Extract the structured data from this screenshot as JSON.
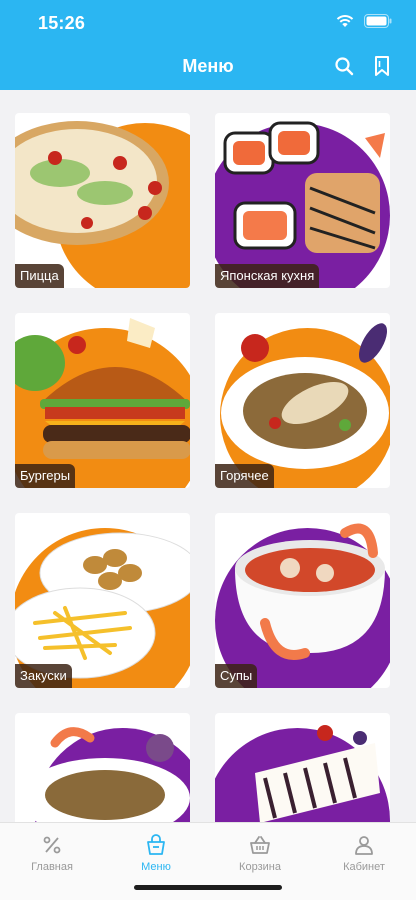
{
  "status": {
    "time": "15:26"
  },
  "header": {
    "title": "Меню"
  },
  "categories": [
    {
      "label": "Пицца"
    },
    {
      "label": "Японская кухня"
    },
    {
      "label": "Бургеры"
    },
    {
      "label": "Горячее"
    },
    {
      "label": "Закуски"
    },
    {
      "label": "Супы"
    },
    {
      "label": ""
    },
    {
      "label": ""
    }
  ],
  "tabs": [
    {
      "label": "Главная",
      "icon": "percent-icon",
      "active": false
    },
    {
      "label": "Меню",
      "icon": "menu-bag-icon",
      "active": true
    },
    {
      "label": "Корзина",
      "icon": "basket-icon",
      "active": false
    },
    {
      "label": "Кабинет",
      "icon": "user-icon",
      "active": false
    }
  ],
  "colors": {
    "accent": "#2bb6f2",
    "orange": "#f28c12",
    "purple": "#7a1fa2"
  }
}
